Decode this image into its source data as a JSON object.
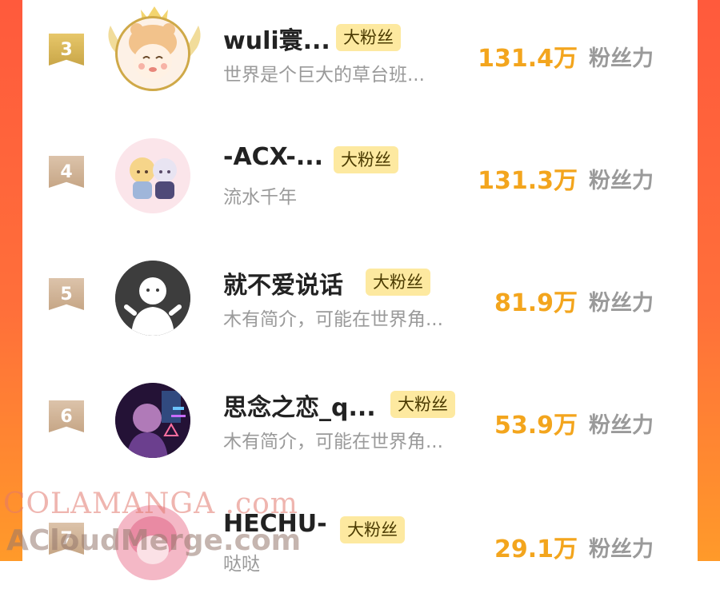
{
  "ranking": {
    "fans_unit_label": "粉丝力",
    "badge_label": "大粉丝",
    "items": [
      {
        "rank": "3",
        "name": "wuli寰...",
        "bio": "世界是个巨大的草台班...",
        "fans": "131.4万",
        "medal": "gold",
        "avatar_icon": "anime-girl-avatar-icon"
      },
      {
        "rank": "4",
        "name": "-ACX-...",
        "bio": "流水千年",
        "fans": "131.3万",
        "medal": "silver",
        "avatar_icon": "two-chibi-characters-avatar-icon"
      },
      {
        "rank": "5",
        "name": "就不爱说话",
        "bio": "木有简介，可能在世界角...",
        "fans": "81.9万",
        "medal": "silver",
        "avatar_icon": "default-user-avatar-icon"
      },
      {
        "rank": "6",
        "name": "思念之恋_q...",
        "bio": "木有简介，可能在世界角...",
        "fans": "53.9万",
        "medal": "silver",
        "avatar_icon": "neon-photo-avatar-icon"
      },
      {
        "rank": "7",
        "name": "HECHU-",
        "bio": "哒哒",
        "fans": "29.1万",
        "medal": "silver",
        "avatar_icon": "pink-anime-avatar-icon"
      }
    ]
  },
  "watermark": {
    "line1": "COLAMANGA .com",
    "line2": "ACloudMerge.com"
  },
  "colors": {
    "accent_gradient_top": "#ff5a3c",
    "accent_gradient_bottom": "#ff9a2a",
    "fans_value": "#f3a51d",
    "badge_bg": "#fde9a0"
  }
}
